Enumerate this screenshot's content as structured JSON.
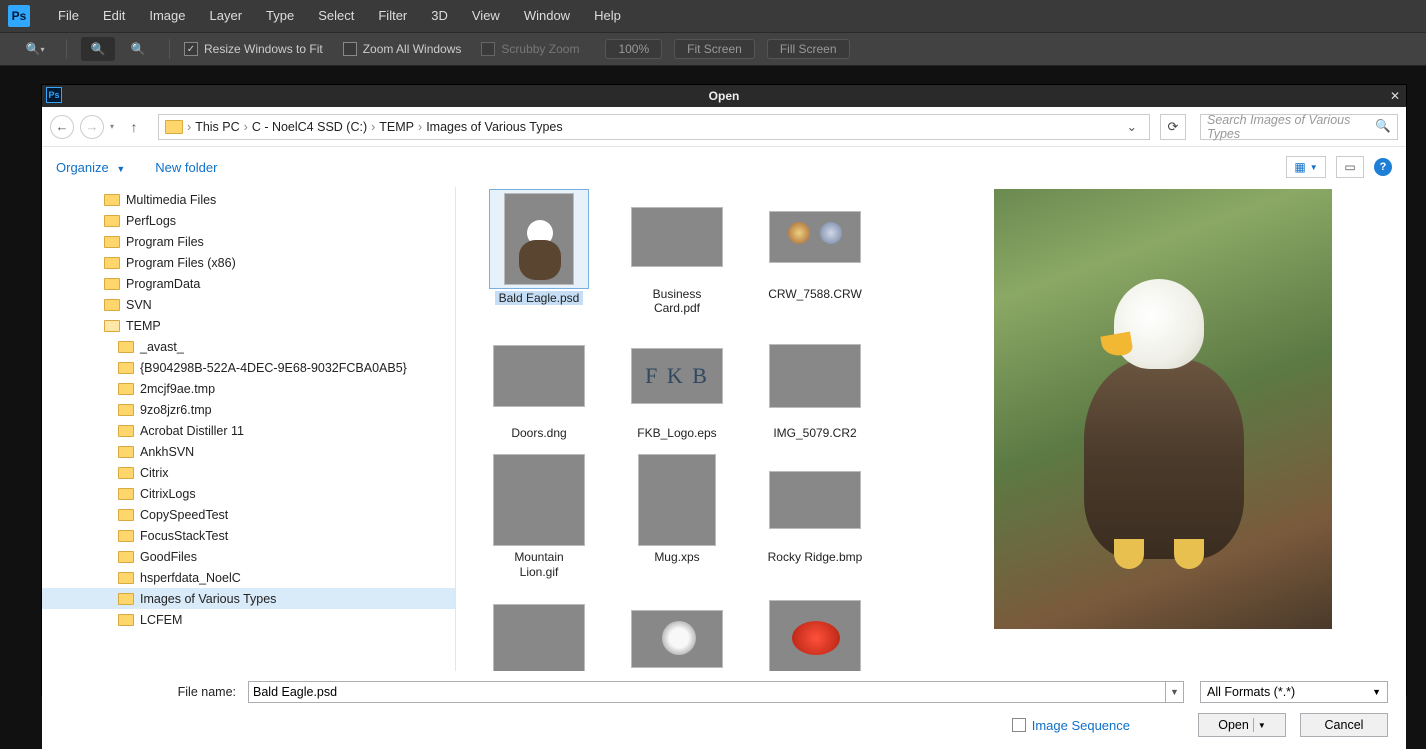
{
  "ps_logo": "Ps",
  "menubar": [
    "File",
    "Edit",
    "Image",
    "Layer",
    "Type",
    "Select",
    "Filter",
    "3D",
    "View",
    "Window",
    "Help"
  ],
  "options": {
    "resize_windows": "Resize Windows to Fit",
    "zoom_all": "Zoom All Windows",
    "scrubby": "Scrubby Zoom",
    "percent": "100%",
    "fit": "Fit Screen",
    "fill": "Fill Screen"
  },
  "dialog": {
    "title": "Open",
    "breadcrumb": {
      "parts": [
        "This PC",
        "C - NoelC4 SSD (C:)",
        "TEMP",
        "Images of Various Types"
      ]
    },
    "search_placeholder": "Search Images of Various Types",
    "toolbar": {
      "organize": "Organize",
      "newfolder": "New folder"
    },
    "tree": [
      {
        "indent": 62,
        "label": "Multimedia Files"
      },
      {
        "indent": 62,
        "label": "PerfLogs"
      },
      {
        "indent": 62,
        "label": "Program Files"
      },
      {
        "indent": 62,
        "label": "Program Files (x86)"
      },
      {
        "indent": 62,
        "label": "ProgramData"
      },
      {
        "indent": 62,
        "label": "SVN"
      },
      {
        "indent": 62,
        "label": "TEMP",
        "open": true
      },
      {
        "indent": 76,
        "label": "_avast_"
      },
      {
        "indent": 76,
        "label": "{B904298B-522A-4DEC-9E68-9032FCBA0AB5}"
      },
      {
        "indent": 76,
        "label": "2mcjf9ae.tmp"
      },
      {
        "indent": 76,
        "label": "9zo8jzr6.tmp"
      },
      {
        "indent": 76,
        "label": "Acrobat Distiller 11"
      },
      {
        "indent": 76,
        "label": "AnkhSVN"
      },
      {
        "indent": 76,
        "label": "Citrix"
      },
      {
        "indent": 76,
        "label": "CitrixLogs"
      },
      {
        "indent": 76,
        "label": "CopySpeedTest"
      },
      {
        "indent": 76,
        "label": "FocusStackTest"
      },
      {
        "indent": 76,
        "label": "GoodFiles"
      },
      {
        "indent": 76,
        "label": "hsperfdata_NoelC"
      },
      {
        "indent": 76,
        "label": "Images of Various Types",
        "sel": true
      },
      {
        "indent": 76,
        "label": "LCFEM"
      }
    ],
    "thumbs": [
      {
        "label": "Bald Eagle.psd",
        "cls": "img-eagle",
        "sel": true
      },
      {
        "label": "Business\nCard.pdf",
        "cls": "img-galaxy"
      },
      {
        "label": "CRW_7588.CRW",
        "cls": "img-planets"
      },
      {
        "label": "Doors.dng",
        "cls": "img-doors"
      },
      {
        "label": "FKB_Logo.eps",
        "cls": "img-fkb",
        "text": "F K B"
      },
      {
        "label": "IMG_5079.CR2",
        "cls": "img-coast"
      },
      {
        "label": "Mountain\nLion.gif",
        "cls": "img-lion"
      },
      {
        "label": "Mug.xps",
        "cls": "img-mug"
      },
      {
        "label": "Rocky Ridge.bmp",
        "cls": "img-ridge"
      },
      {
        "label": "",
        "cls": "img-mtn"
      },
      {
        "label": "",
        "cls": "img-watch"
      },
      {
        "label": "",
        "cls": "img-tomato"
      }
    ],
    "filename_label": "File name:",
    "filename_value": "Bald Eagle.psd",
    "format": "All Formats (*.*)",
    "image_sequence": "Image Sequence",
    "open_btn": "Open",
    "cancel_btn": "Cancel"
  }
}
